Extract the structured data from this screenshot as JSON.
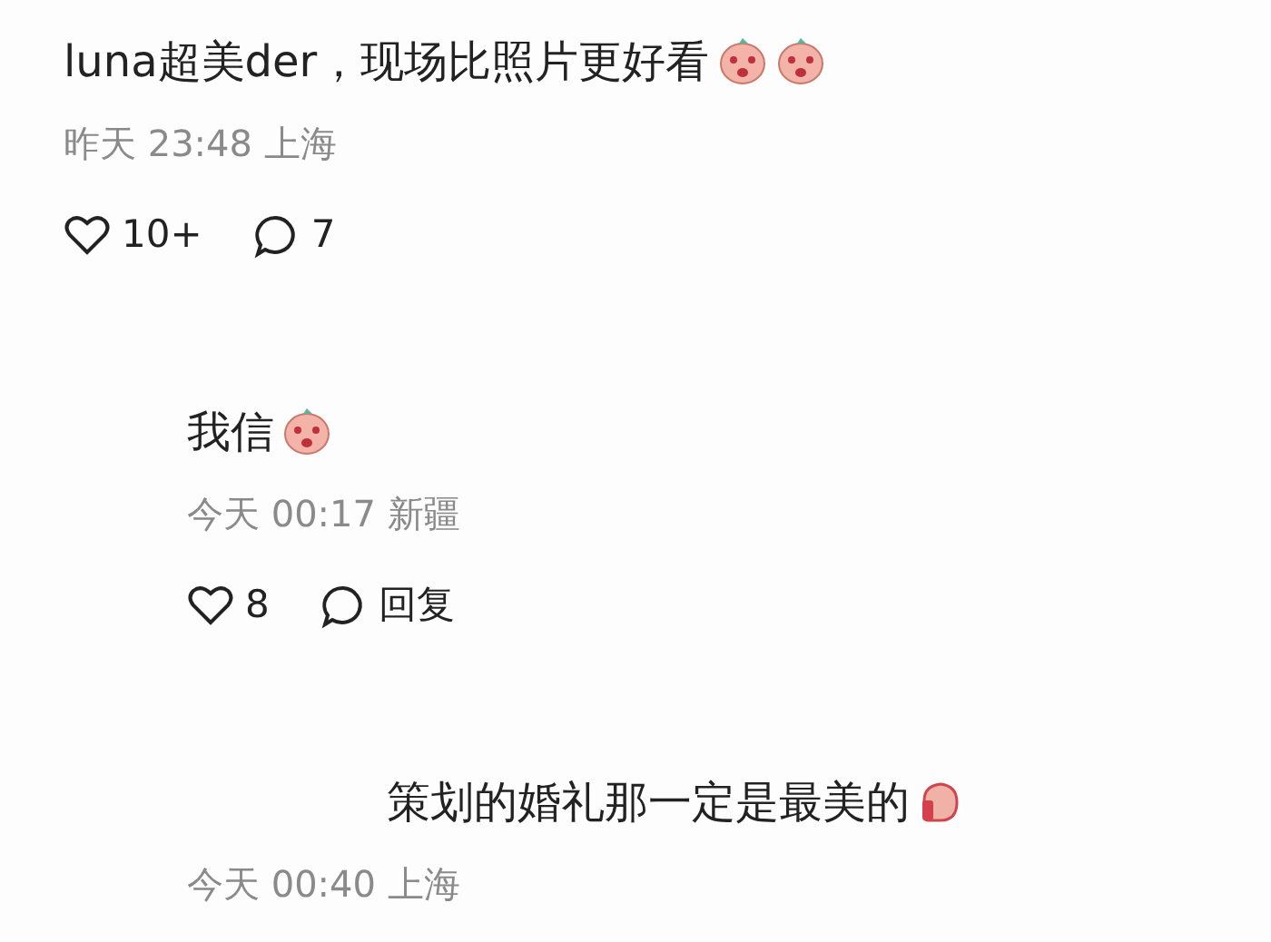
{
  "comments": [
    {
      "kind": "top",
      "text": "luna超美der，现场比照片更好看",
      "time": "昨天 23:48 上海",
      "likes": "10+",
      "reply": "7"
    },
    {
      "kind": "reply",
      "text": "我信",
      "time": "今天 00:17 新疆",
      "likes": "8",
      "reply": "回复"
    },
    {
      "kind": "reply_offset",
      "text": "策划的婚礼那一定是最美的",
      "time": "今天 00:40 上海"
    }
  ]
}
